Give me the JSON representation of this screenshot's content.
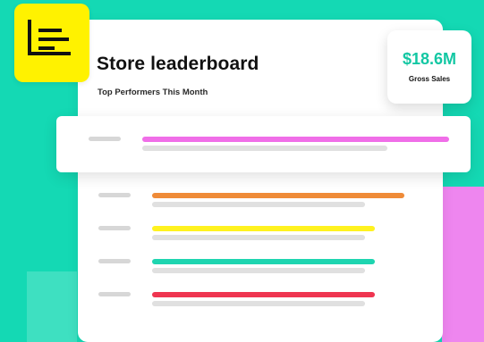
{
  "card": {
    "title": "Store leaderboard",
    "subtitle": "Top Performers This Month"
  },
  "stat": {
    "value": "$18.6M",
    "label": "Gross Sales"
  },
  "leaderboard": {
    "rows": [
      {
        "name": "leader-row-1",
        "bar_color": "#f06ee8",
        "bar_percent": 100,
        "highlighted": true
      },
      {
        "name": "leader-row-2",
        "bar_color": "#ef8b38",
        "bar_percent": 95,
        "highlighted": false
      },
      {
        "name": "leader-row-3",
        "bar_color": "#fff21f",
        "bar_percent": 84,
        "highlighted": false
      },
      {
        "name": "leader-row-4",
        "bar_color": "#1ed5b0",
        "bar_percent": 84,
        "highlighted": false
      },
      {
        "name": "leader-row-5",
        "bar_color": "#ef3550",
        "bar_percent": 84,
        "highlighted": false
      }
    ]
  },
  "icons": {
    "logo": "leaderboard-icon"
  },
  "colors": {
    "background": "#14d9b4",
    "logo_bg": "#fff200",
    "stat_accent": "#13c7a3",
    "decor_pink": "#ee86ef"
  }
}
